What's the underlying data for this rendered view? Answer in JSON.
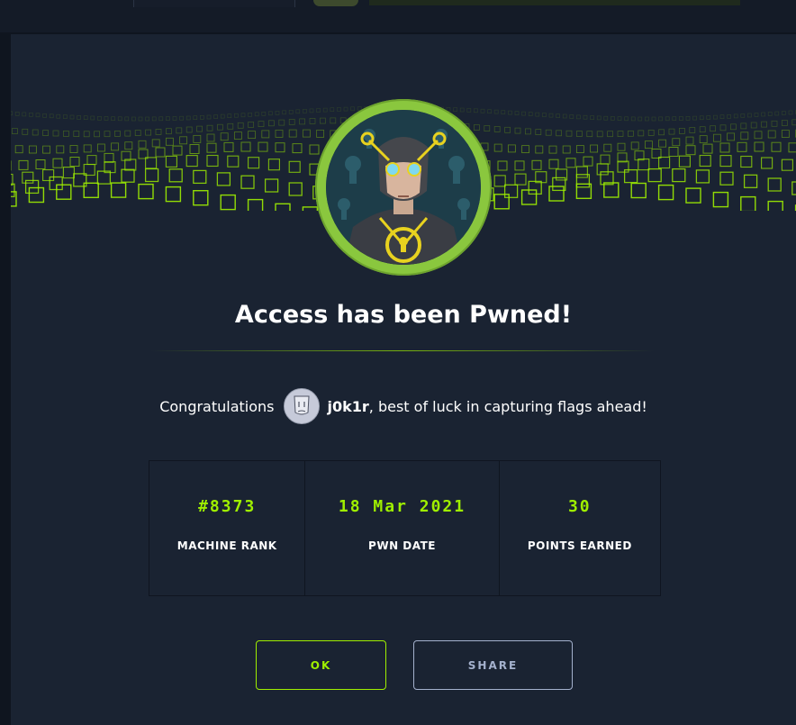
{
  "modal": {
    "title": "Access has been Pwned!",
    "congrats_prefix": "Congratulations",
    "username": "j0k1r",
    "congrats_suffix": ", best of luck in capturing flags ahead!",
    "stats": [
      {
        "value": "#8373",
        "label": "MACHINE RANK"
      },
      {
        "value": "18 Mar 2021",
        "label": "PWN DATE"
      },
      {
        "value": "30",
        "label": "POINTS EARNED"
      }
    ],
    "buttons": {
      "ok": "OK",
      "share": "SHARE"
    }
  },
  "colors": {
    "accent": "#9fef00",
    "modal_bg": "#1a2332",
    "page_bg": "#0f151f",
    "ring": "#8ac73e",
    "share_border": "#a4b1cd"
  },
  "icons": {
    "machine_avatar": "keyhole-hero-avatar",
    "user_avatar": "user-avatar-face"
  }
}
